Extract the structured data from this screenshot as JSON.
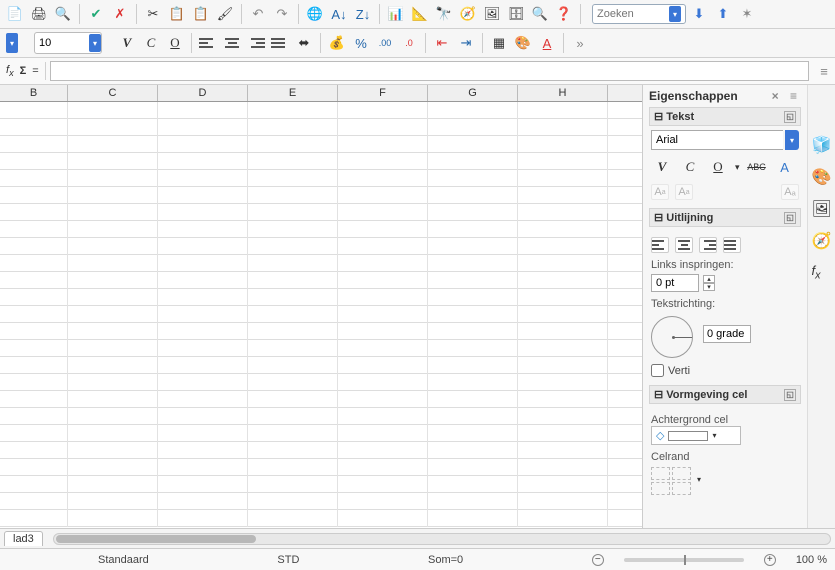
{
  "toolbar1": {
    "search_placeholder": "Zoeken"
  },
  "toolbar2": {
    "font_size": "10"
  },
  "formula": {
    "value": ""
  },
  "columns": [
    "B",
    "C",
    "D",
    "E",
    "F",
    "G",
    "H"
  ],
  "side": {
    "title": "Eigenschappen",
    "text_panel": {
      "label": "Tekst",
      "font": "Arial"
    },
    "align_panel": {
      "label": "Uitlijning",
      "indent_label": "Links inspringen:",
      "indent_value": "0 pt",
      "dir_label": "Tekstrichting:",
      "degrees_value": "0 grade",
      "vertical_label": "Verti"
    },
    "cell_panel": {
      "label": "Vormgeving cel",
      "bg_label": "Achtergrond cel",
      "border_label": "Celrand"
    }
  },
  "tabs": {
    "sheet": "lad3"
  },
  "status": {
    "style": "Standaard",
    "mode": "STD",
    "sum": "Som=0",
    "zoom": "100 %"
  }
}
